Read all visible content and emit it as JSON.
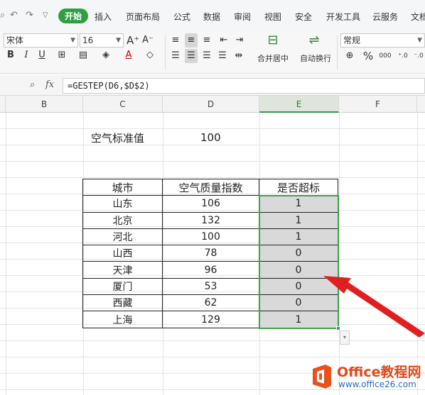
{
  "menubar": {
    "tabs": [
      "开始",
      "插入",
      "页面布局",
      "公式",
      "数据",
      "审阅",
      "视图",
      "安全",
      "开发工具",
      "云服务",
      "文档"
    ]
  },
  "ribbon": {
    "font_name": "宋体",
    "font_size": "16",
    "merge_label": "合并居中",
    "wrap_label": "自动换行",
    "number_format": "常规",
    "percent_symbol": "%",
    "thousands_symbol": "000"
  },
  "formula_bar": {
    "fx_label": "fx",
    "formula": "=GESTEP(D6,$D$2)"
  },
  "columns": [
    "B",
    "C",
    "D",
    "E",
    "F"
  ],
  "sheet": {
    "standard_label": "空气标准值",
    "standard_value": "100",
    "headers": [
      "城市",
      "空气质量指数",
      "是否超标"
    ],
    "rows": [
      [
        "山东",
        "106",
        "1"
      ],
      [
        "北京",
        "132",
        "1"
      ],
      [
        "河北",
        "100",
        "1"
      ],
      [
        "山西",
        "78",
        "0"
      ],
      [
        "天津",
        "96",
        "0"
      ],
      [
        "厦门",
        "53",
        "0"
      ],
      [
        "西藏",
        "62",
        "0"
      ],
      [
        "上海",
        "129",
        "1"
      ]
    ]
  },
  "watermark": {
    "name": "Office教程网",
    "url": "www.office26.com"
  },
  "colors": {
    "accent": "#2ea043",
    "selection": "#3fa04a",
    "arrow": "#e02020",
    "highlight_fill": "#d9d9d9"
  }
}
